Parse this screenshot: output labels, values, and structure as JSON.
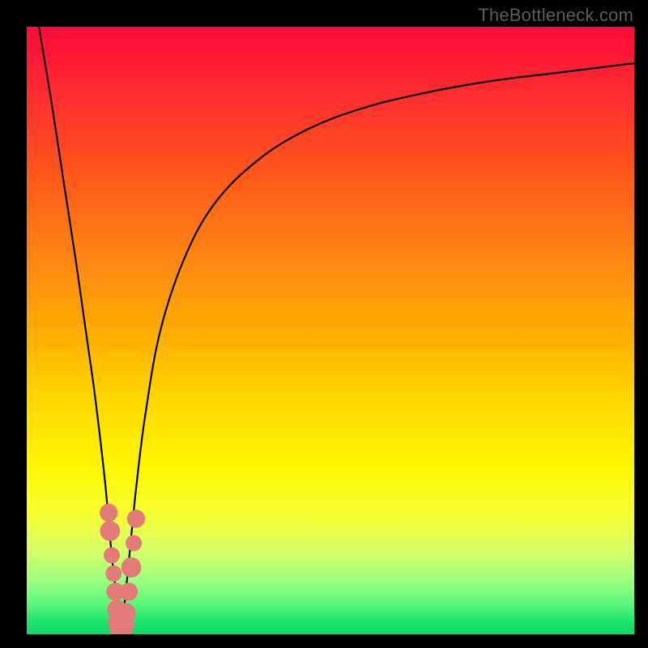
{
  "watermark": "TheBottleneck.com",
  "chart_data": {
    "type": "line",
    "title": "",
    "xlabel": "",
    "ylabel": "",
    "xlim": [
      0,
      100
    ],
    "ylim": [
      0,
      100
    ],
    "background_gradient": {
      "top_color": "#ff0a3a",
      "bottom_color": "#0fd86c",
      "meaning": "red high / green low"
    },
    "series": [
      {
        "name": "left-branch",
        "x": [
          2,
          4,
          6,
          8,
          10,
          11,
          12,
          13,
          13.7,
          14.2,
          14.7,
          15.1,
          15.5
        ],
        "y": [
          100,
          88,
          75,
          62,
          48,
          41,
          33,
          24,
          16,
          11,
          7,
          3,
          0
        ]
      },
      {
        "name": "right-branch",
        "x": [
          15.5,
          16.2,
          17,
          18,
          19.5,
          22,
          26,
          31,
          38,
          46,
          55,
          65,
          76,
          88,
          100
        ],
        "y": [
          0,
          6,
          14,
          24,
          36,
          50,
          62,
          71,
          78,
          83,
          86.5,
          89,
          91,
          92.5,
          94
        ]
      }
    ],
    "markers": {
      "name": "highlighted-points",
      "note": "salmon dots clustered around the curve minimum",
      "points": [
        {
          "x": 13.5,
          "y": 20,
          "r": 1.2
        },
        {
          "x": 13.7,
          "y": 17,
          "r": 1.4
        },
        {
          "x": 14.0,
          "y": 13,
          "r": 1.0
        },
        {
          "x": 14.3,
          "y": 10,
          "r": 1.0
        },
        {
          "x": 14.6,
          "y": 7,
          "r": 1.2
        },
        {
          "x": 14.9,
          "y": 4,
          "r": 1.4
        },
        {
          "x": 15.2,
          "y": 2,
          "r": 1.6
        },
        {
          "x": 15.5,
          "y": 0.8,
          "r": 1.6
        },
        {
          "x": 15.9,
          "y": 1.5,
          "r": 1.6
        },
        {
          "x": 16.3,
          "y": 3.5,
          "r": 1.4
        },
        {
          "x": 16.8,
          "y": 7,
          "r": 1.2
        },
        {
          "x": 17.2,
          "y": 11,
          "r": 1.4
        },
        {
          "x": 17.6,
          "y": 15,
          "r": 1.0
        },
        {
          "x": 18.0,
          "y": 19,
          "r": 1.2
        }
      ]
    },
    "minimum_at_x": 15.5
  }
}
